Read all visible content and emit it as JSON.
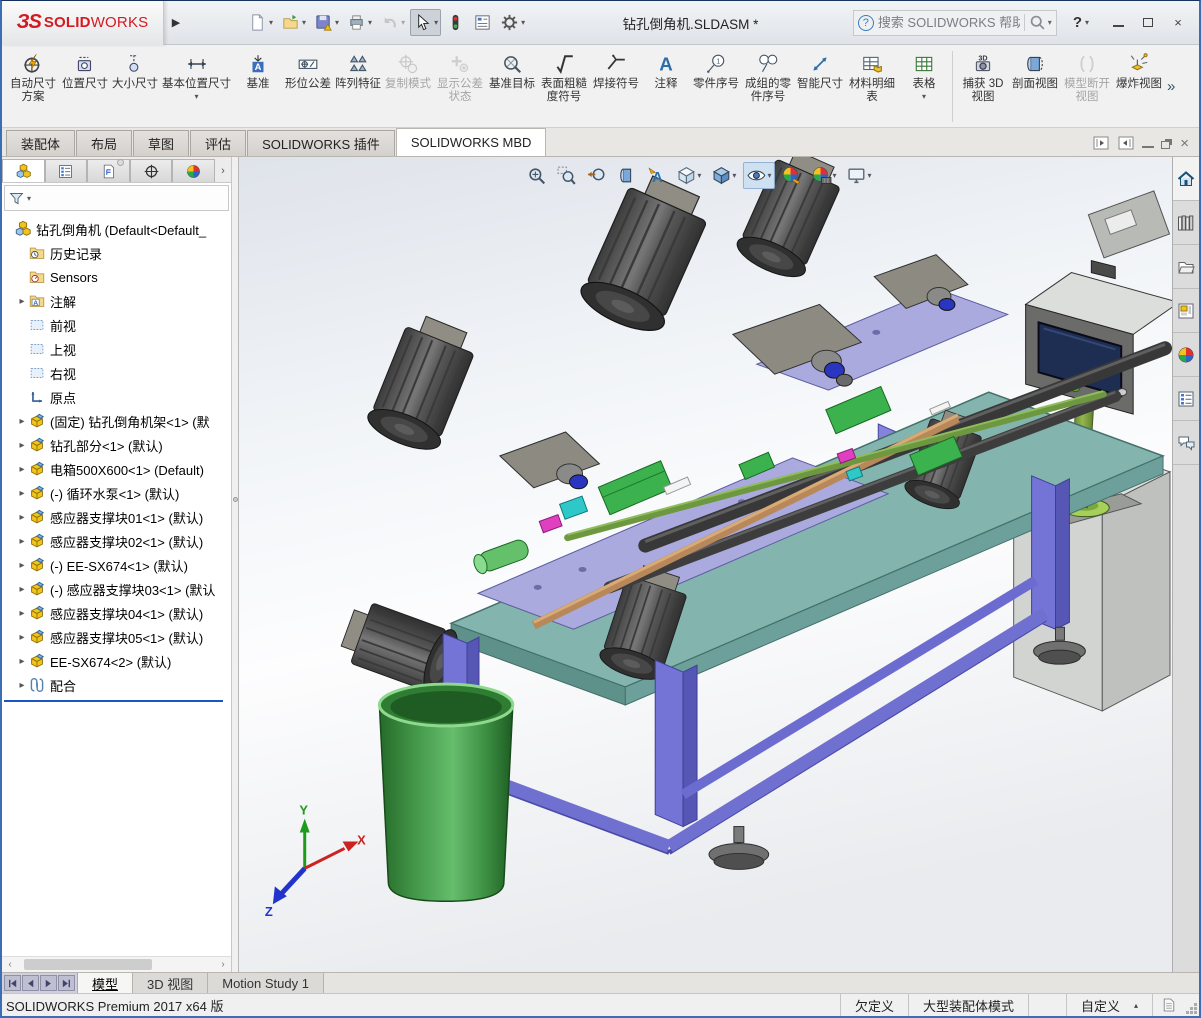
{
  "window": {
    "brand_prefix": "ЗS",
    "brand_bold": "SOLID",
    "brand_light": "WORKS",
    "title": "钻孔倒角机.SLDASM *",
    "search_placeholder": "搜索 SOLIDWORKS 帮助",
    "help_label": "?",
    "flyout": "▶"
  },
  "quick_toolbar": [
    {
      "icon": "new",
      "name": "new-document-button",
      "dropdown": true
    },
    {
      "icon": "open",
      "name": "open-button",
      "dropdown": true
    },
    {
      "icon": "save",
      "name": "save-button",
      "dropdown": true
    },
    {
      "icon": "print",
      "name": "print-button",
      "dropdown": true
    },
    {
      "icon": "undo",
      "name": "undo-button",
      "dropdown": true,
      "disabled": true
    },
    {
      "icon": "cursor",
      "name": "select-button",
      "dropdown": true,
      "pressed": true
    },
    {
      "icon": "perf",
      "name": "performance-evaluation-button"
    },
    {
      "icon": "report",
      "name": "assembly-visualization-button"
    },
    {
      "icon": "gear",
      "name": "options-button",
      "dropdown": true
    }
  ],
  "ribbon": {
    "overflow": "»",
    "buttons": [
      {
        "label": "自动尺寸方案",
        "icon": "autodim"
      },
      {
        "label": "位置尺寸",
        "icon": "locdim"
      },
      {
        "label": "大小尺寸",
        "icon": "sizedim"
      },
      {
        "label": "基本位置尺寸",
        "icon": "basicdim",
        "dropdown": true,
        "wide": true
      },
      {
        "label": "基准",
        "icon": "datum"
      },
      {
        "label": "形位公差",
        "icon": "geotol"
      },
      {
        "label": "阵列特征",
        "icon": "pattern"
      },
      {
        "label": "复制模式",
        "icon": "copyscheme",
        "disabled": true
      },
      {
        "label": "显示公差状态",
        "icon": "tolstatus",
        "disabled": true
      },
      {
        "label": "基准目标",
        "icon": "datumtarget"
      },
      {
        "label": "表面粗糙度符号",
        "icon": "surface"
      },
      {
        "label": "焊接符号",
        "icon": "weld"
      },
      {
        "label": "注释",
        "icon": "note"
      },
      {
        "label": "零件序号",
        "icon": "balloon"
      },
      {
        "label": "成组的零件序号",
        "icon": "stackballoon"
      },
      {
        "label": "智能尺寸",
        "icon": "smartdim"
      },
      {
        "label": "材料明细表",
        "icon": "bom"
      },
      {
        "label": "表格",
        "icon": "table",
        "dropdown": true
      },
      {
        "sep": true
      },
      {
        "label": "捕获 3D 视图",
        "icon": "capture3d"
      },
      {
        "label": "剖面视图",
        "icon": "section"
      },
      {
        "label": "模型断开视图",
        "icon": "breakview",
        "disabled": true
      },
      {
        "label": "爆炸视图",
        "icon": "explode"
      }
    ]
  },
  "command_tabs": [
    {
      "label": "装配体"
    },
    {
      "label": "布局"
    },
    {
      "label": "草图"
    },
    {
      "label": "评估"
    },
    {
      "label": "SOLIDWORKS 插件"
    },
    {
      "label": "SOLIDWORKS MBD",
      "active": true
    }
  ],
  "feature_panel": {
    "tabs": [
      {
        "name": "featuremanager-tab",
        "icon": "assembly",
        "active": true
      },
      {
        "name": "propertymanager-tab",
        "icon": "proplist"
      },
      {
        "name": "configurationmanager-tab",
        "icon": "proppage"
      },
      {
        "name": "dimxpertmanager-tab",
        "icon": "target"
      },
      {
        "name": "displaymanager-tab",
        "icon": "sphere"
      }
    ],
    "more_arrow": "›",
    "tree": [
      {
        "icon": "assembly",
        "label": "钻孔倒角机 (Default<Default_",
        "level": 0
      },
      {
        "icon": "history",
        "label": "历史记录",
        "level": 1
      },
      {
        "icon": "sensors",
        "label": "Sensors",
        "level": 1
      },
      {
        "icon": "annfolder",
        "label": "注解",
        "level": 1,
        "expand": true
      },
      {
        "icon": "plane",
        "label": "前视",
        "level": 1
      },
      {
        "icon": "plane",
        "label": "上视",
        "level": 1
      },
      {
        "icon": "plane",
        "label": "右视",
        "level": 1
      },
      {
        "icon": "origin",
        "label": "原点",
        "level": 1
      },
      {
        "icon": "part",
        "label": "(固定) 钻孔倒角机架<1> (默",
        "level": 1,
        "expand": true
      },
      {
        "icon": "part",
        "label": "钻孔部分<1> (默认)",
        "level": 1,
        "expand": true
      },
      {
        "icon": "part",
        "label": "电箱500X600<1> (Default)",
        "level": 1,
        "expand": true
      },
      {
        "icon": "part",
        "label": "(-) 循环水泵<1> (默认)",
        "level": 1,
        "expand": true
      },
      {
        "icon": "part",
        "label": "感应器支撑块01<1> (默认)",
        "level": 1,
        "expand": true
      },
      {
        "icon": "part",
        "label": "感应器支撑块02<1> (默认)",
        "level": 1,
        "expand": true
      },
      {
        "icon": "part",
        "label": "(-) EE-SX674<1> (默认)",
        "level": 1,
        "expand": true
      },
      {
        "icon": "part",
        "label": "(-) 感应器支撑块03<1> (默认",
        "level": 1,
        "expand": true
      },
      {
        "icon": "part",
        "label": "感应器支撑块04<1> (默认)",
        "level": 1,
        "expand": true
      },
      {
        "icon": "part",
        "label": "感应器支撑块05<1> (默认)",
        "level": 1,
        "expand": true
      },
      {
        "icon": "part",
        "label": "EE-SX674<2> (默认)",
        "level": 1,
        "expand": true
      },
      {
        "icon": "mates",
        "label": "配合",
        "level": 1,
        "expand": true,
        "last": true
      }
    ]
  },
  "viewport": {
    "heads_up": [
      {
        "name": "zoom-fit",
        "icon": "zoomfit"
      },
      {
        "name": "zoom-area",
        "icon": "zoomarea"
      },
      {
        "name": "previous-view",
        "icon": "prev"
      },
      {
        "name": "section-view",
        "icon": "sectionv"
      },
      {
        "name": "annotation-views",
        "icon": "annviews"
      },
      {
        "name": "view-orientation",
        "icon": "vcube",
        "dropdown": true
      },
      {
        "name": "display-style",
        "icon": "dcube",
        "dropdown": true
      },
      {
        "name": "hide-show-items",
        "icon": "eye",
        "dropdown": true,
        "pressed": true
      },
      {
        "name": "edit-appearance",
        "icon": "appearance"
      },
      {
        "name": "apply-scene",
        "icon": "scene",
        "dropdown": true
      },
      {
        "name": "view-settings",
        "icon": "monitor",
        "dropdown": true
      }
    ],
    "task_pane": [
      {
        "name": "home",
        "icon": "home",
        "active": true
      },
      {
        "name": "design-library",
        "icon": "library"
      },
      {
        "name": "file-explorer",
        "icon": "folder"
      },
      {
        "name": "view-palette",
        "icon": "palette"
      },
      {
        "name": "appearances-scenes",
        "icon": "sphere"
      },
      {
        "name": "custom-properties",
        "icon": "props"
      },
      {
        "name": "solidworks-forum",
        "icon": "forum"
      }
    ],
    "triad": {
      "x": "X",
      "y": "Y",
      "z": "Z"
    }
  },
  "bottom_bar": {
    "tabs": [
      {
        "label": "模型",
        "active": true
      },
      {
        "label": "3D 视图"
      },
      {
        "label": "Motion Study 1"
      }
    ]
  },
  "status_bar": {
    "left": "SOLIDWORKS Premium 2017 x64 版",
    "define_state": "欠定义",
    "mode": "大型装配体模式",
    "custom": "自定义"
  },
  "colors": {
    "brand_red": "#d61920",
    "window_border": "#3a6eb5",
    "frame_purple": "#7474d6",
    "table_teal": "#83b4ae",
    "plate_lavender": "#abaade",
    "bucket_green": "#3c8f42",
    "pole_green": "#7fa03f",
    "clamp_green": "#3cb24e",
    "pressed_blue": "#cfe0f0"
  }
}
